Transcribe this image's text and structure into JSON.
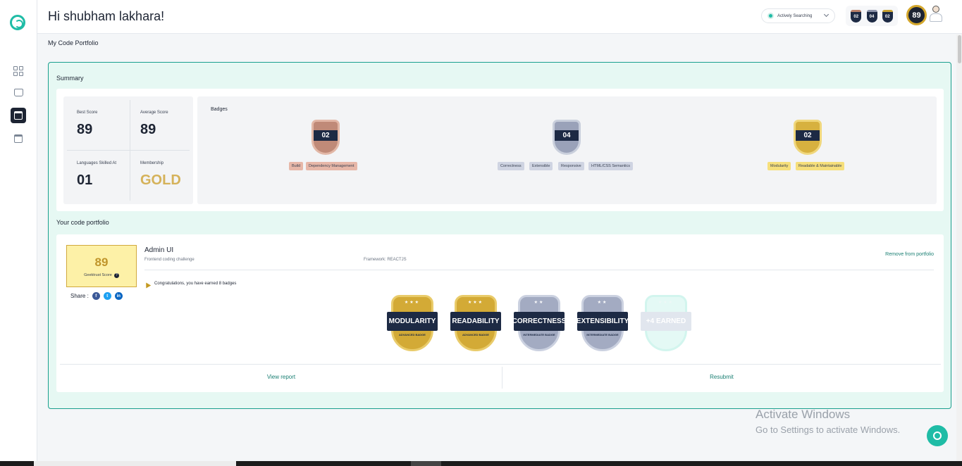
{
  "header": {
    "greeting": "Hi shubham lakhara!",
    "status": "Actively Searching",
    "profile_score": "89",
    "mini_badges": [
      {
        "value": "02",
        "color": "#b9806a"
      },
      {
        "value": "04",
        "color": "#8d94aa"
      },
      {
        "value": "02",
        "color": "#c9a233"
      }
    ]
  },
  "page": {
    "title": "My Code Portfolio"
  },
  "summary": {
    "title": "Summary",
    "stats": [
      {
        "label": "Best Score",
        "value": "89"
      },
      {
        "label": "Average Score",
        "value": "89"
      },
      {
        "label": "Languages Skilled At",
        "value": "01"
      },
      {
        "label": "Membership",
        "value": "GOLD"
      }
    ],
    "badges_title": "Badges",
    "badge_groups": [
      {
        "count": "02",
        "tier": "bronze",
        "chips": [
          "Build",
          "Dependency Management"
        ]
      },
      {
        "count": "04",
        "tier": "silver",
        "chips": [
          "Correctness",
          "Extensible",
          "Responsive",
          "HTML/CSS Semantics"
        ]
      },
      {
        "count": "02",
        "tier": "gold",
        "chips": [
          "Modularity",
          "Readable & Maintainable"
        ]
      }
    ]
  },
  "portfolio": {
    "title": "Your code portfolio",
    "score": "89",
    "score_label": "Geektrust Score",
    "share_label": "Share :",
    "project_name": "Admin UI",
    "project_type": "Frontend coding challenge",
    "framework": "Framework: REACTJS",
    "remove_label": "Remove from portfolio",
    "congrats": "Congratulations, you have earned 8 badges",
    "badges": [
      {
        "name": "MODULARITY",
        "sub": "ADVANCED BADGE",
        "tier": "gold"
      },
      {
        "name": "READABILITY",
        "sub": "ADVANCED BADGE",
        "tier": "gold"
      },
      {
        "name": "CORRECTNESS",
        "sub": "INTERMEDIATE BADGE",
        "tier": "silver"
      },
      {
        "name": "EXTENSIBILITY",
        "sub": "INTERMEDIATE BADGE",
        "tier": "silver"
      },
      {
        "name": "+4 EARNED",
        "sub": "",
        "tier": "more"
      }
    ],
    "view_report": "View report",
    "resubmit": "Resubmit"
  },
  "windows": {
    "watermark_title": "Activate Windows",
    "watermark_sub": "Go to Settings to activate Windows."
  },
  "colors": {
    "accent": "#1fbca6",
    "panel_bg": "#e6f8f3",
    "gold": "#d5b25a",
    "navy": "#1d2433"
  }
}
